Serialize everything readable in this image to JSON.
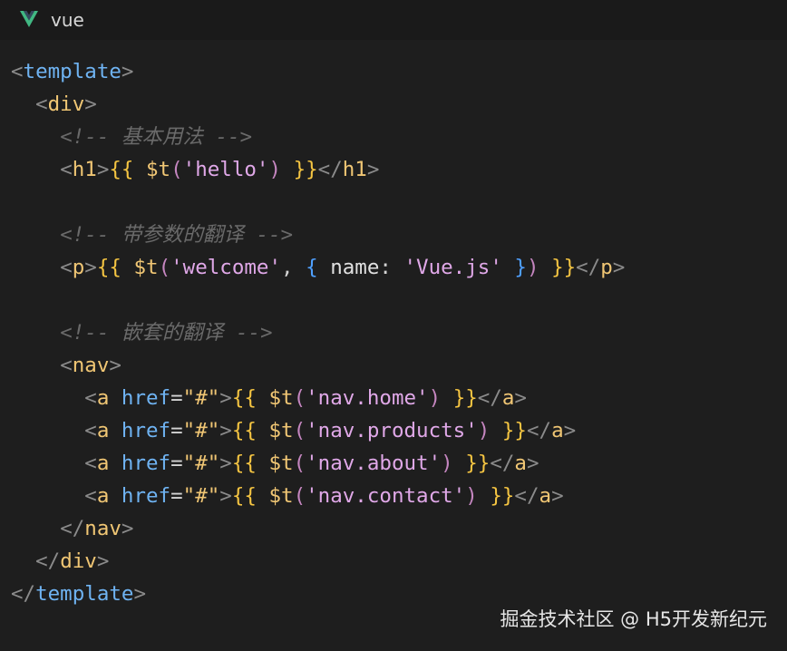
{
  "header": {
    "logo_icon": "vue-logo-icon",
    "language": "vue"
  },
  "colors": {
    "background": "#1e1e1e",
    "header_background": "#1a1a1a",
    "tag_name": "#f0c674",
    "template_tag": "#6fb3f2",
    "comment": "#6a6a6a",
    "mustache": "#f5c542",
    "string": "#e0a8e8",
    "attribute": "#6fb3f2",
    "object_brace": "#4fa0ff",
    "vue_green": "#41b883",
    "vue_dark": "#35495e"
  },
  "code": {
    "lines": [
      "<template>",
      "  <div>",
      "    <!-- 基本用法 -->",
      "    <h1>{{ $t('hello') }}</h1>",
      "",
      "    <!-- 带参数的翻译 -->",
      "    <p>{{ $t('welcome', { name: 'Vue.js' }) }}</p>",
      "",
      "    <!-- 嵌套的翻译 -->",
      "    <nav>",
      "      <a href=\"#\">{{ $t('nav.home') }}</a>",
      "      <a href=\"#\">{{ $t('nav.products') }}</a>",
      "      <a href=\"#\">{{ $t('nav.about') }}</a>",
      "      <a href=\"#\">{{ $t('nav.contact') }}</a>",
      "    </nav>",
      "  </div>",
      "</template>"
    ]
  },
  "watermark": "掘金技术社区 @ H5开发新纪元"
}
